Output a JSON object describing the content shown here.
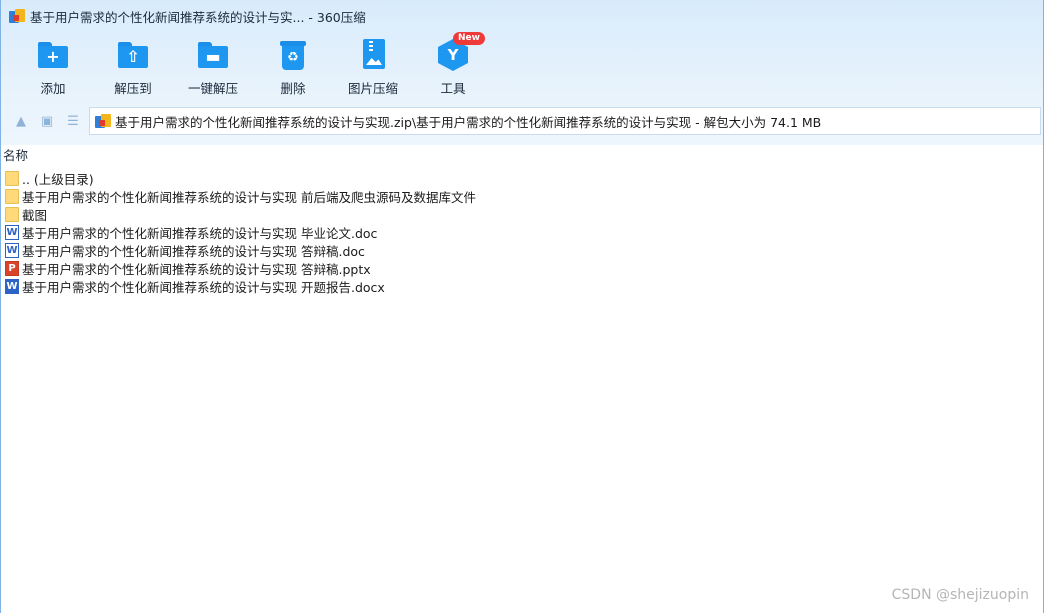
{
  "window": {
    "title": "基于用户需求的个性化新闻推荐系统的设计与实... - 360压缩"
  },
  "toolbar": {
    "items": [
      {
        "label": "添加",
        "icon": "add-folder-icon"
      },
      {
        "label": "解压到",
        "icon": "extract-to-icon"
      },
      {
        "label": "一键解压",
        "icon": "one-click-extract-icon"
      },
      {
        "label": "删除",
        "icon": "delete-trash-icon"
      },
      {
        "label": "图片压缩",
        "icon": "image-compress-icon"
      },
      {
        "label": "工具",
        "icon": "tools-hex-icon"
      }
    ],
    "new_badge": "New"
  },
  "navbar": {
    "address": "基于用户需求的个性化新闻推荐系统的设计与实现.zip\\基于用户需求的个性化新闻推荐系统的设计与实现 - 解包大小为 74.1 MB"
  },
  "list": {
    "column_name": "名称",
    "files": [
      {
        "name": ".. (上级目录)",
        "type": "folder"
      },
      {
        "name": "基于用户需求的个性化新闻推荐系统的设计与实现 前后端及爬虫源码及数据库文件",
        "type": "folder"
      },
      {
        "name": "截图",
        "type": "folder"
      },
      {
        "name": "基于用户需求的个性化新闻推荐系统的设计与实现 毕业论文.doc",
        "type": "doc"
      },
      {
        "name": "基于用户需求的个性化新闻推荐系统的设计与实现 答辩稿.doc",
        "type": "doc"
      },
      {
        "name": "基于用户需求的个性化新闻推荐系统的设计与实现 答辩稿.pptx",
        "type": "pptx"
      },
      {
        "name": "基于用户需求的个性化新闻推荐系统的设计与实现 开题报告.docx",
        "type": "docx"
      }
    ]
  },
  "watermark": "CSDN @shejizuopin",
  "colors": {
    "accent": "#1d97f0",
    "header_bg": "#dcedfb",
    "badge": "#f03a3a"
  }
}
